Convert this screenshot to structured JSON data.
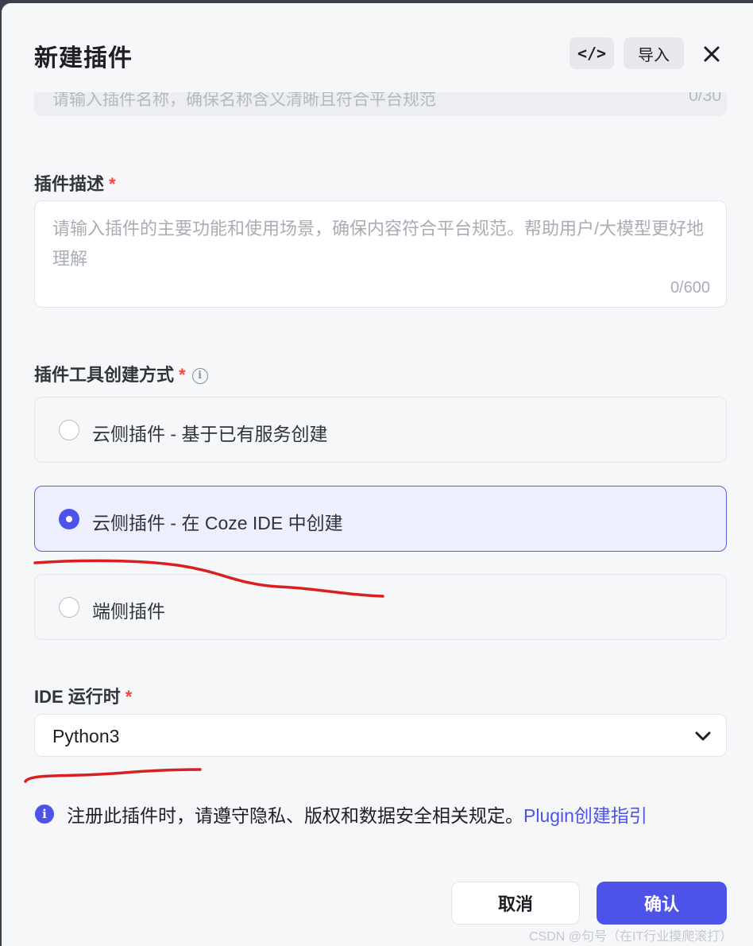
{
  "header": {
    "title": "新建插件",
    "code_button": "</>",
    "import_button": "导入",
    "close_icon": "close-icon"
  },
  "name_field": {
    "placeholder": "请输入插件名称，确保名称含义清晰且符合平台规范",
    "counter": "0/30"
  },
  "description": {
    "label": "插件描述",
    "required_mark": "*",
    "placeholder": "请输入插件的主要功能和使用场景，确保内容符合平台规范。帮助用户/大模型更好地理解",
    "counter": "0/600"
  },
  "creation_method": {
    "label": "插件工具创建方式",
    "required_mark": "*",
    "info_icon": "ⓘ",
    "options": [
      {
        "label": "云侧插件 - 基于已有服务创建",
        "selected": false
      },
      {
        "label": "云侧插件 - 在 Coze IDE 中创建",
        "selected": true
      },
      {
        "label": "端侧插件",
        "selected": false
      }
    ]
  },
  "runtime": {
    "label": "IDE 运行时",
    "required_mark": "*",
    "selected_value": "Python3"
  },
  "notice": {
    "icon": "i",
    "text": "注册此插件时，请遵守隐私、版权和数据安全相关规定。",
    "link_text": "Plugin创建指引"
  },
  "footer": {
    "cancel_label": "取消",
    "confirm_label": "确认"
  },
  "watermark": "CSDN @句号（在IT行业摸爬滚打）",
  "colors": {
    "accent": "#4d53e8",
    "required": "#f5453a",
    "annotation": "#d92020"
  }
}
